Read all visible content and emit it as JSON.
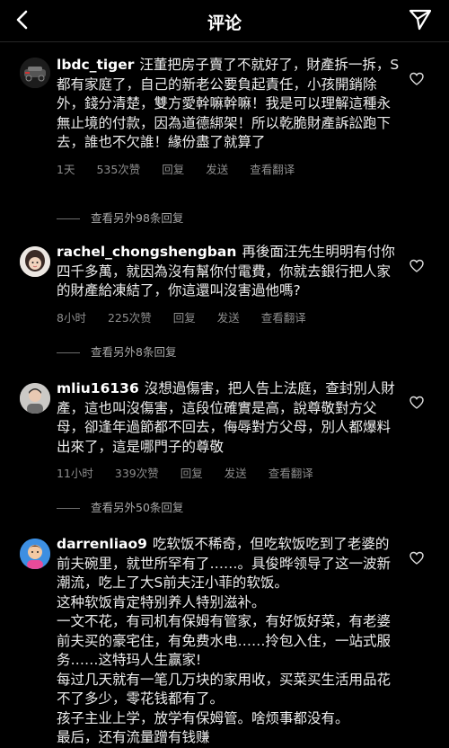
{
  "header": {
    "title": "评论"
  },
  "comments": [
    {
      "username": "lbdc_tiger",
      "text": "汪董把房子賣了不就好了，財產拆一拆，S都有家庭了，自己的新老公要負起責任，小孩開銷除外，錢分清楚，雙方愛幹嘛幹嘛！我是可以理解這種永無止境的付款，因為道德綁架！所以乾脆財產訴訟跑下去，誰也不欠誰！緣份盡了就算了",
      "time": "1天",
      "likes": "535次赞",
      "reply_label": "回复",
      "send_label": "发送",
      "translate_label": "查看翻译",
      "view_replies": "查看另外98条回复"
    },
    {
      "username": "rachel_chongshengban",
      "text": "再後面汪先生明明有付你四千多萬，就因為沒有幫你付電費，你就去銀行把人家的財產給凍結了，你這還叫沒害過他嗎?",
      "time": "8小时",
      "likes": "225次赞",
      "reply_label": "回复",
      "send_label": "发送",
      "translate_label": "查看翻译",
      "view_replies": "查看另外8条回复"
    },
    {
      "username": "mliu16136",
      "text": "沒想過傷害，把人告上法庭，查封別人財產，這也叫沒傷害，這段位確實是高，說尊敬對方父母，卻逢年過節都不回去，侮辱對方父母，別人都爆料出來了，這是哪門子的尊敬",
      "time": "11小时",
      "likes": "339次赞",
      "reply_label": "回复",
      "send_label": "发送",
      "translate_label": "查看翻译",
      "view_replies": "查看另外50条回复"
    },
    {
      "username": "darrenliao9",
      "text": "吃软饭不稀奇，但吃软饭吃到了老婆的前夫碗里，就世所罕有了……。具俊晔领导了这一波新潮流，吃上了大S前夫汪小菲的软饭。",
      "paragraphs": [
        "这种软饭肯定特别养人特别滋补。",
        "一文不花，有司机有保姆有管家，有好饭好菜，有老婆前夫买的豪宅住，有免费水电……拎包入住，一站式服务……这特玛人生赢家!",
        "每过几天就有一笔几万块的家用收，买菜买生活用品花不了多少，零花钱都有了。",
        "孩子主业上学，放学有保姆管。啥烦事都没有。",
        "最后，还有流量蹭有钱赚"
      ]
    }
  ],
  "colors": {
    "background": "#000000",
    "text": "#ececec",
    "meta": "#8e8e8e"
  },
  "icons": [
    "back-arrow-icon",
    "send-paper-plane-icon",
    "heart-outline-icon"
  ]
}
